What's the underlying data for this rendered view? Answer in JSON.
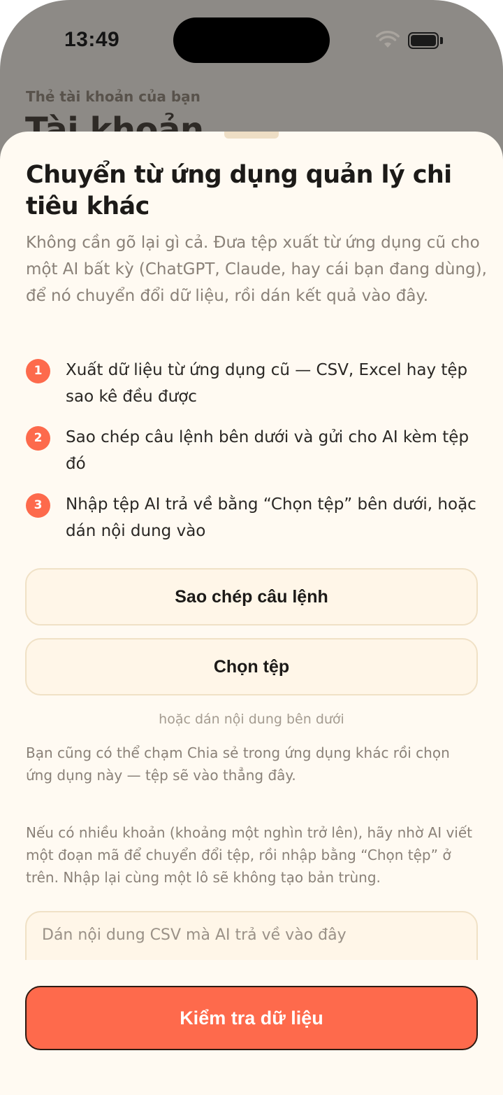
{
  "status_bar": {
    "time": "13:49",
    "icons": [
      "wifi-icon",
      "battery-icon"
    ]
  },
  "background_page": {
    "subtitle": "Thẻ tài khoản của bạn",
    "title": "Tài khoản"
  },
  "sheet": {
    "title": "Chuyển từ ứng dụng quản lý chi tiêu khác",
    "intro": "Không cần gõ lại gì cả. Đưa tệp xuất từ ứng dụng cũ cho một AI bất kỳ (ChatGPT, Claude, hay cái bạn đang dùng), để nó chuyển đổi dữ liệu, rồi dán kết quả vào đây.",
    "steps": [
      {
        "number": "1",
        "text": "Xuất dữ liệu từ ứng dụng cũ — CSV, Excel hay tệp sao kê đều được"
      },
      {
        "number": "2",
        "text": "Sao chép câu lệnh bên dưới và gửi cho AI kèm tệp đó"
      },
      {
        "number": "3",
        "text": "Nhập tệp AI trả về bằng “Chọn tệp” bên dưới, hoặc dán nội dung vào"
      }
    ],
    "copy_prompt_label": "Sao chép câu lệnh",
    "choose_file_label": "Chọn tệp",
    "or_paste_text": "hoặc dán nội dung bên dưới",
    "share_note": "Bạn cũng có thể chạm Chia sẻ trong ứng dụng khác rồi chọn ứng dụng này — tệp sẽ vào thẳng đây.",
    "many_items_note": "Nếu có nhiều khoản (khoảng một nghìn trở lên), hãy nhờ AI viết một đoạn mã để chuyển đổi tệp, rồi nhập bằng “Chọn tệp” ở trên. Nhập lại cùng một lô sẽ không tạo bản trùng.",
    "paste_placeholder": "Dán nội dung CSV mà AI trả về vào đây",
    "check_data_label": "Kiểm tra dữ liệu"
  },
  "colors": {
    "accent": "#fe6a4c",
    "sheet_background": "#fffaf2",
    "button_background": "#fff6e8",
    "button_border": "#f0e1c6",
    "dimmed_background": "#8d8a86"
  }
}
